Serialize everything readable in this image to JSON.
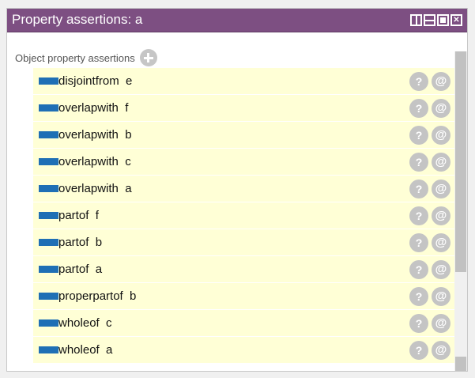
{
  "panel": {
    "title": "Property assertions: a",
    "window_buttons": [
      "split-vertical-icon",
      "split-horizontal-icon",
      "maximize-icon",
      "close-icon"
    ]
  },
  "section": {
    "label": "Object property assertions",
    "add_icon": "plus-icon"
  },
  "assertions": [
    {
      "text": "disjointfrom  e"
    },
    {
      "text": "overlapwith  f"
    },
    {
      "text": "overlapwith  b"
    },
    {
      "text": "overlapwith  c"
    },
    {
      "text": "overlapwith  a"
    },
    {
      "text": "partof  f"
    },
    {
      "text": "partof  b"
    },
    {
      "text": "partof  a"
    },
    {
      "text": "properpartof  b"
    },
    {
      "text": "wholeof  c"
    },
    {
      "text": "wholeof  a"
    }
  ],
  "row_buttons": {
    "help_glyph": "?",
    "annotate_glyph": "@"
  },
  "colors": {
    "titlebar": "#7d4f82",
    "row_background": "#ffffd6",
    "property_icon": "#1f6fb5",
    "row_button": "#c4c4c4"
  }
}
